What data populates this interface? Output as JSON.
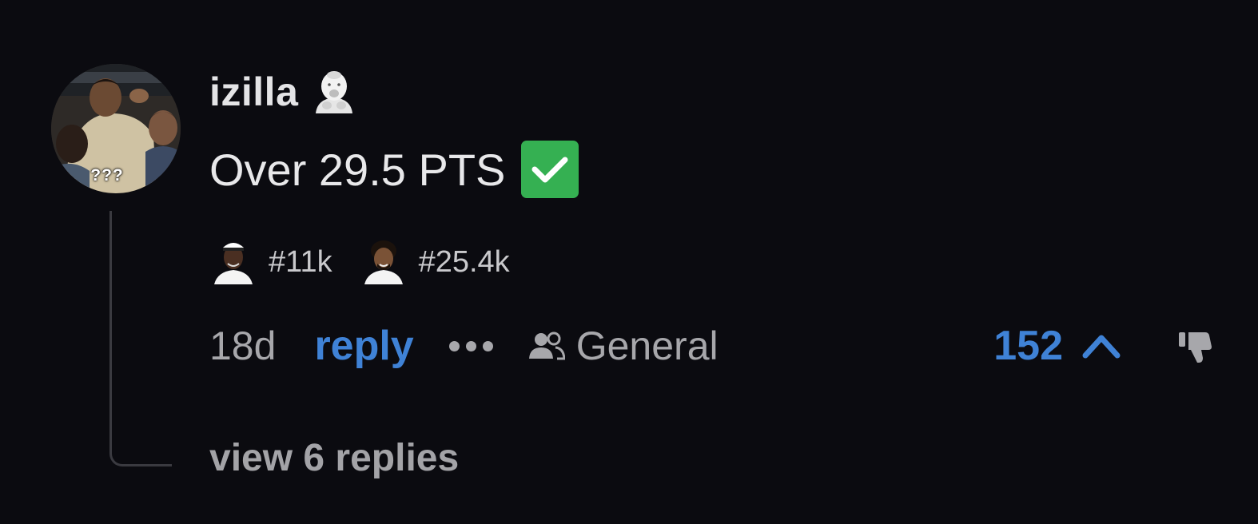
{
  "comment": {
    "avatar": {
      "caption": "???",
      "icon": "user-photo-avatar"
    },
    "username": "izilla",
    "user_badge_icon": "baby-emoji-icon",
    "body": "Over 29.5 PTS",
    "body_emoji": "check-mark-button-icon",
    "player_tags": [
      {
        "label": "#11k",
        "icon": "player-headshot-icon"
      },
      {
        "label": "#25.4k",
        "icon": "player-headshot-icon"
      }
    ],
    "time": "18d",
    "reply_label": "reply",
    "more_icon": "ellipsis-icon",
    "community_icon": "users-icon",
    "community_label": "General",
    "vote_count": "152",
    "upvote_icon": "chevron-up-icon",
    "downvote_icon": "thumbs-down-icon",
    "view_replies_label": "view 6 replies"
  },
  "colors": {
    "background": "#0b0b10",
    "accent": "#3f82d6",
    "muted": "#a7a7ab",
    "check_green": "#35b052"
  }
}
